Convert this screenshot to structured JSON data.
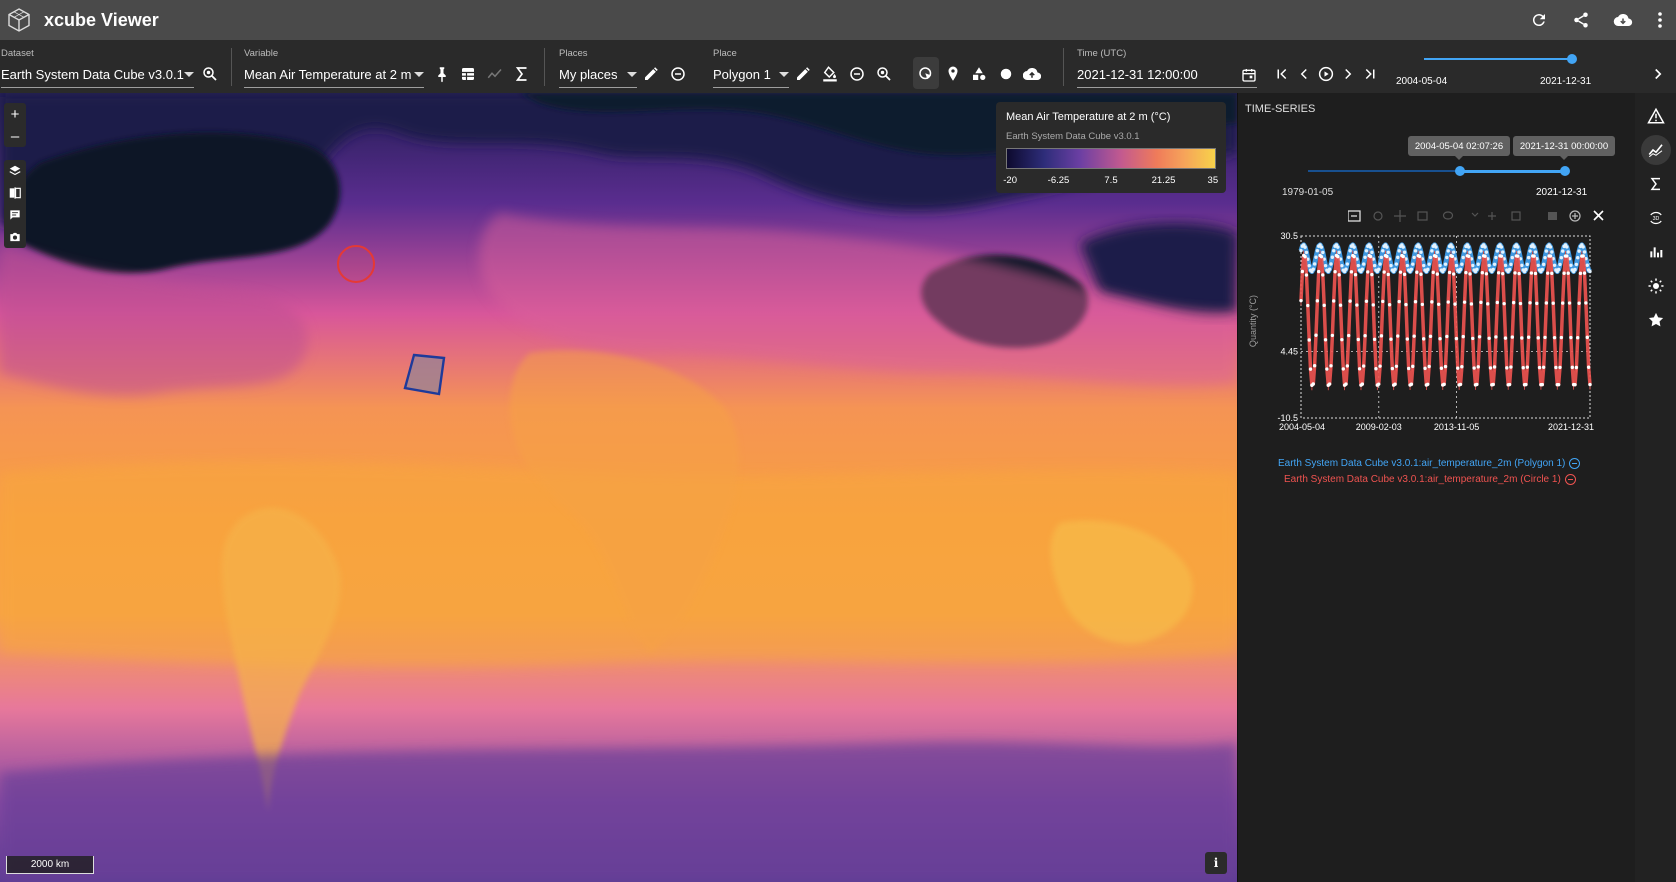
{
  "app": {
    "title": "xcube Viewer",
    "actions": [
      "refresh-icon",
      "share-icon",
      "cloud-download-icon",
      "more-vert-icon"
    ]
  },
  "controls": {
    "dataset": {
      "label": "Dataset",
      "value": "Earth System Data Cube v3.0.1"
    },
    "variable": {
      "label": "Variable",
      "value": "Mean Air Temperature at 2 m"
    },
    "places": {
      "label": "Places",
      "value": "My places"
    },
    "place": {
      "label": "Place",
      "value": "Polygon 1"
    },
    "time": {
      "label": "Time (UTC)",
      "value": "2021-12-31 12:00:00"
    },
    "time_slider": {
      "start": "2004-05-04",
      "end": "2021-12-31",
      "position": 1.0
    }
  },
  "map": {
    "scale_label": "2000 km",
    "info_label": "i",
    "zoom_in": "+",
    "zoom_out": "–"
  },
  "legend": {
    "title": "Mean Air Temperature at 2 m (°C)",
    "subtitle": "Earth System Data Cube v3.0.1",
    "ticks": [
      "-20",
      "-6.25",
      "7.5",
      "21.25",
      "35"
    ],
    "range": [
      -20,
      35
    ]
  },
  "panel": {
    "title": "TIME-SERIES",
    "range_slider": {
      "min_label": "1979-01-05",
      "max_label": "2021-12-31",
      "low_tooltip": "2004-05-04 02:07:26",
      "high_tooltip": "2021-12-31 00:00:00",
      "low_fraction": 0.59,
      "high_fraction": 1.0
    }
  },
  "chart_data": {
    "type": "line",
    "ylabel": "Quantity (°C)",
    "xlabel": "",
    "x_ticks": [
      "2004-05-04",
      "2009-02-03",
      "2013-11-05",
      "2021-12-31"
    ],
    "y_ticks": [
      "30.5",
      "4.45",
      "-10.5"
    ],
    "ylim": [
      -10.5,
      30.5
    ],
    "xlim": [
      "2004-05-04",
      "2021-12-31"
    ],
    "grid": true,
    "series": [
      {
        "name": "Earth System Data Cube v3.0.1:air_temperature_2m (Polygon 1)",
        "color": "#42a5f5",
        "min": 22.5,
        "max": 28.5,
        "cycles_per_year": 1
      },
      {
        "name": "Earth System Data Cube v3.0.1:air_temperature_2m (Circle 1)",
        "color": "#ef5350",
        "min": -3.5,
        "max": 26.5,
        "cycles_per_year": 1
      }
    ],
    "years": 17.66
  }
}
